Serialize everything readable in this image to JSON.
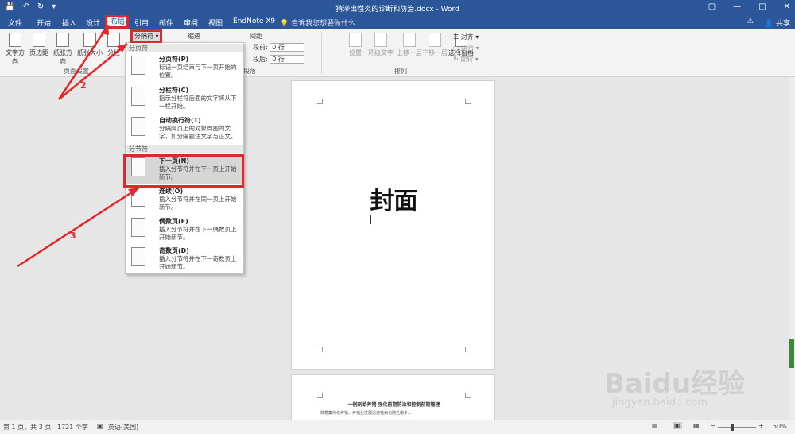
{
  "window": {
    "title": "猜滲出性炎的诊断和防治.docx - Word"
  },
  "tabs": [
    "文件",
    "开始",
    "插入",
    "设计",
    "布局",
    "引用",
    "邮件",
    "审阅",
    "视图",
    "EndNote X9"
  ],
  "active_tab": "布局",
  "tell_me": "告诉我您想要做什么...",
  "share": "共享",
  "ribbon": {
    "page_setup": {
      "label": "页面设置",
      "buttons": [
        "文字方向",
        "页边距",
        "纸张方向",
        "纸张大小",
        "分栏"
      ]
    },
    "breaks_button": "分隔符",
    "indent_label": "缩进",
    "spacing_label": "间距",
    "before_label": "段前:",
    "before_value": "0 行",
    "after_label": "段后:",
    "after_value": "0 行",
    "paragraph_label": "段落",
    "arrange": {
      "label": "排列",
      "buttons": [
        "位置",
        "环绕文字",
        "上移一层",
        "下移一层",
        "选择窗格"
      ],
      "align": "对齐",
      "group": "组合",
      "rotate": "旋转"
    }
  },
  "breaks_menu": {
    "section1_header": "分页符",
    "section2_header": "分节符",
    "items": [
      {
        "title": "分页符(P)",
        "desc": "标记一页结束与下一页开始的位置。"
      },
      {
        "title": "分栏符(C)",
        "desc": "指示分栏符后面的文字将从下一栏开始。"
      },
      {
        "title": "自动换行符(T)",
        "desc": "分隔网页上的对象周围的文字，如分隔题注文字与正文。"
      },
      {
        "title": "下一页(N)",
        "desc": "插入分节符并在下一页上开始新节。"
      },
      {
        "title": "连续(O)",
        "desc": "插入分节符并在同一页上开始新节。"
      },
      {
        "title": "偶数页(E)",
        "desc": "插入分节符并在下一偶数页上开始新节。"
      },
      {
        "title": "奇数页(D)",
        "desc": "插入分节符并在下一奇数页上开始新节。"
      }
    ]
  },
  "annotations": {
    "step2": "2",
    "step3": "3"
  },
  "document": {
    "cover_title": "封面",
    "page2_heading": "一例剂蛤养猪 强化前期防治和控制前期管理",
    "page2_body": "随着集约化养猪，养猪业发展迅速猪病也随之增多..."
  },
  "status": {
    "page": "第 1 页，共 3 页",
    "words": "1721 个字",
    "language": "英语(美国)",
    "zoom": "50%"
  },
  "watermark": {
    "brand": "Baidu经验",
    "url": "jingyan.baidu.com"
  },
  "colors": {
    "word_blue": "#2b579a",
    "highlight_red": "#e0282a"
  }
}
